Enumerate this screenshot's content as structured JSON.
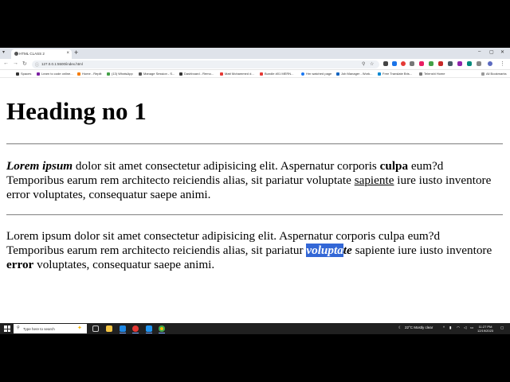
{
  "browser": {
    "tab_title": "HTML CLASS 2",
    "address": "127.0.0.1:5500/index.html",
    "bookmarks": [
      "Spaces",
      "Learn to code online...",
      "Home - Replit",
      "(13) WhatsApp",
      "Manage Session - S...",
      "Dashboard - Remo...",
      "Matt Mohammed d...",
      "Bundle #01 MERN...",
      "Hm watched page",
      "Job Manager - Work...",
      "Free Translate Bris...",
      "Telenshi Home"
    ],
    "all_bookmarks": "All Bookmarks"
  },
  "page": {
    "heading": "Heading no 1",
    "p1": {
      "lead": "Lorem ipsum",
      "t1": " dolor sit amet consectetur adipisicing elit. Aspernatur corporis ",
      "bold": "culpa",
      "t2": " eum?d Temporibus earum rem architecto reiciendis alias, sit pariatur voluptate ",
      "underline": "sapiente",
      "t3": " iure iusto inventore error voluptates, consequatur saepe animi."
    },
    "p2": {
      "t1": "Lorem ipsum dolor sit amet consectetur adipisicing elit. Aspernatur corporis culpa eum?d Temporibus earum rem architecto reiciendis alias, sit pariatur ",
      "selected": "volupta",
      "after_sel": "te",
      "t2": " sapiente iure iusto inventore ",
      "bold": "error",
      "t3": " voluptates, consequatur saepe animi."
    }
  },
  "taskbar": {
    "search_placeholder": "Type here to search",
    "weather": "22°C  Mostly clear",
    "time": "11:27 PM",
    "date": "12/19/2023"
  },
  "colors": {
    "selection": "#3367d6",
    "taskbar": "#202020",
    "tabstrip": "#dfe3ea"
  }
}
